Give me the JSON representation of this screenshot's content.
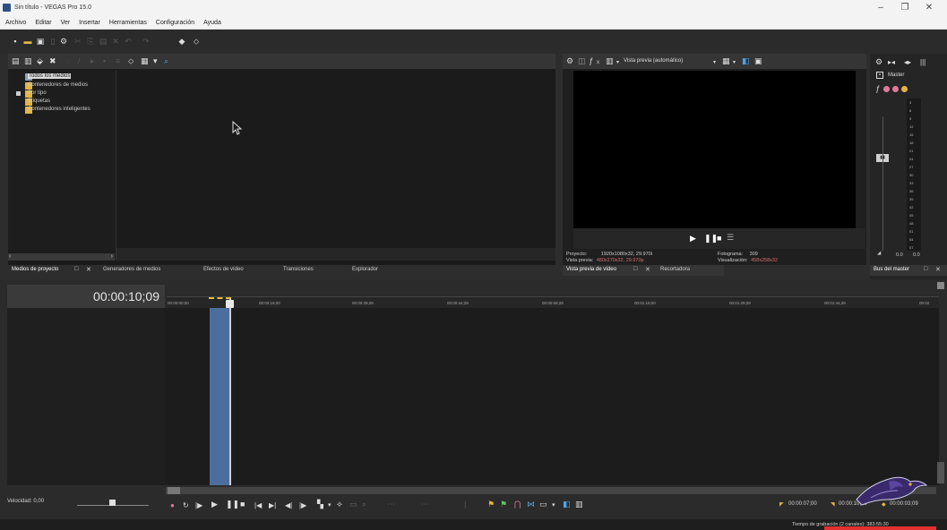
{
  "window": {
    "title": "Sin título - VEGAS Pro 15.0",
    "minimize": "–",
    "maximize": "❐",
    "close": "✕"
  },
  "menu": [
    "Archivo",
    "Editar",
    "Ver",
    "Insertar",
    "Herramientas",
    "Configuración",
    "Ayuda"
  ],
  "media_tree": {
    "items": [
      "Todos los medios",
      "Contenedores de medios",
      "Por tipo",
      "Etiquetas",
      "Contenedores inteligentes"
    ]
  },
  "left_tabs": [
    "Medios de proyecto",
    "Generadores de medios",
    "Efectos de vídeo",
    "Transiciones",
    "Explorador"
  ],
  "preview": {
    "mode_label": "Vista previa (automático)",
    "proyecto_label": "Proyecto:",
    "proyecto_value": "1920x1080x32, 29.970i",
    "vista_label": "Vista previa:",
    "vista_value": "480x270x32, 29.970p",
    "fotograma_label": "Fotograma:",
    "fotograma_value": "309",
    "visual_label": "Visualización:",
    "visual_value": "458x258x32"
  },
  "preview_tabs": [
    "Vista previa de vídeo",
    "Recortadora"
  ],
  "mixer": {
    "master_label": "Master",
    "scale": [
      "3",
      "6",
      "9",
      "12",
      "15",
      "18",
      "21",
      "24",
      "27",
      "30",
      "33",
      "36",
      "39",
      "42",
      "45",
      "48",
      "51",
      "54",
      "57"
    ],
    "left_value": "0.0",
    "right_value": "0.0",
    "tab_label": "Bus del master"
  },
  "timeline": {
    "timecode": "00:00:10;09",
    "ruler_ticks": [
      "00:00:00;00",
      "00:00:15;00",
      "00:00:29;29",
      "00:00:44;29",
      "00:00:59;28",
      "00:01:15;00",
      "00:01:29;29",
      "00:01:44;29",
      "00:02"
    ]
  },
  "transport": {
    "speed_label": "Velocidad: 0,00",
    "time_start": "00:00:07;00",
    "time_end": "00:00:10;09",
    "time_length": "00:00:03;09"
  },
  "status": {
    "text": "Tiempo de grabación (2 canales): 383:55:30"
  },
  "colors": {
    "accent": "#4b6e9e",
    "folder": "#e7b443",
    "alert": "#e23030"
  }
}
